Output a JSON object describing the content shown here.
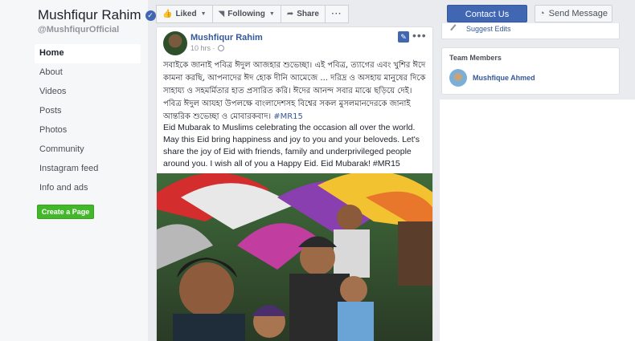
{
  "page": {
    "name": "Mushfiqur Rahim",
    "handle": "@MushfiqurOfficial"
  },
  "sidebar": {
    "items": [
      {
        "label": "Home",
        "active": true
      },
      {
        "label": "About"
      },
      {
        "label": "Videos"
      },
      {
        "label": "Posts"
      },
      {
        "label": "Photos"
      },
      {
        "label": "Community"
      },
      {
        "label": "Instagram feed"
      },
      {
        "label": "Info and ads"
      }
    ],
    "create_page": "Create a Page"
  },
  "actions": {
    "liked": "Liked",
    "following": "Following",
    "share": "Share",
    "more": "···",
    "contact": "Contact Us",
    "message": "Send Message"
  },
  "post": {
    "author": "Mushfiqur Rahim",
    "time": "10 hrs ·",
    "more": "•••",
    "bangla_text": "সবাইকে জানাই পবিত্র ঈদুল আজহার শুভেচ্ছা। এই পবিত্র, ত্যাগের এবং খুশির ঈদে কামনা করছি, আপনাদের ঈদ হোক দীনি আমেজে ... দরিদ্র ও অসহায় মানুষের দিকে সাহায্য ও সহমর্মিতার হাত প্রসারিত করি। ঈদের আনন্দ সবার মাঝে ছড়িয়ে দেই। পবিত্র ঈদুল আযহা উপলক্ষে বাংলাদেশসহ বিশ্বের সকল মুসলমানদেরকে জানাই আন্তরিক শুভেচ্ছা ও মোবারকবাদ।",
    "bangla_hashtag": "#MR15",
    "english_text": "Eid Mubarak to Muslims celebrating the occasion all over the world. May this Eid bring happiness and joy to you and your beloveds. Let's share the joy of Eid with friends, family and underprivileged people around you. I wish all of you a Happy Eid. Eid Mubarak!",
    "english_hashtag": "#MR15"
  },
  "right": {
    "suggest_edits": "Suggest Edits",
    "team_title": "Team Members",
    "team_member": "Mushfique Ahmed"
  },
  "colors": {
    "brand_blue": "#4267b2",
    "link_blue": "#365899",
    "green": "#42b72a",
    "background": "#e9ebee"
  }
}
